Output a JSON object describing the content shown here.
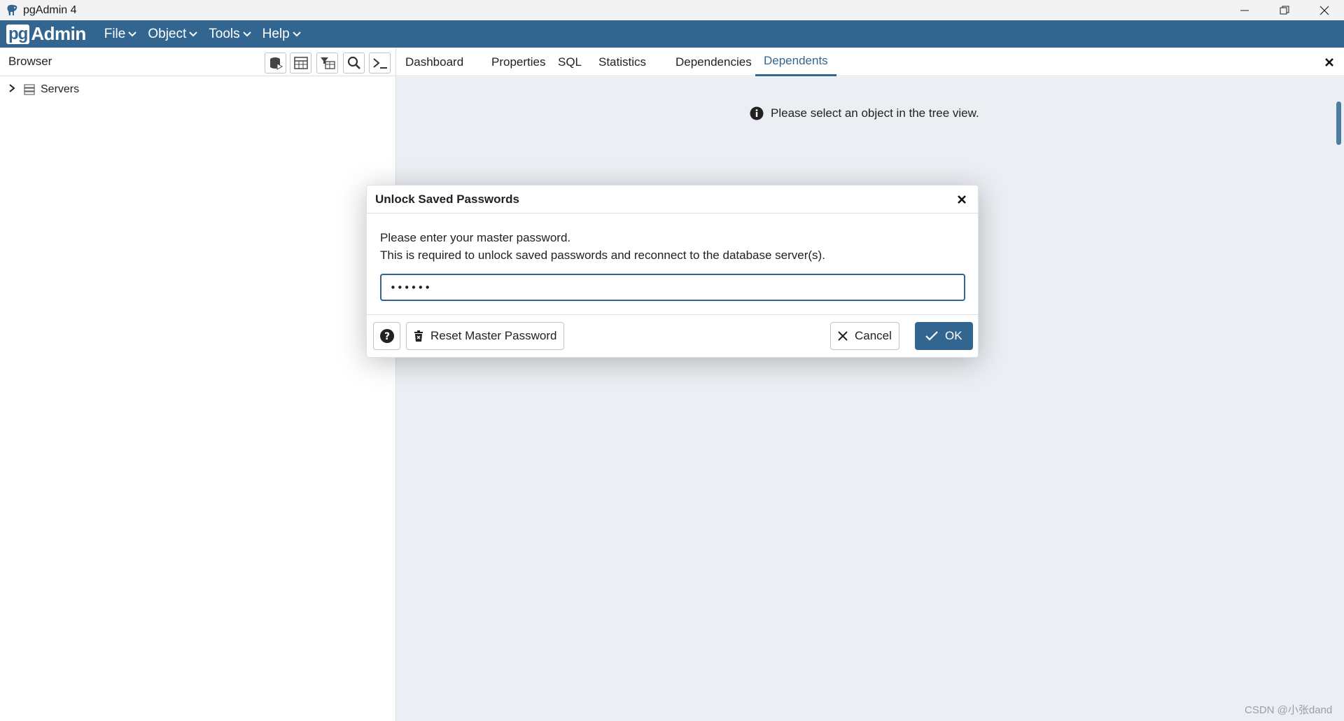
{
  "window": {
    "title": "pgAdmin 4",
    "controls": [
      "minimize-icon",
      "restore-icon",
      "close-icon"
    ]
  },
  "menubar": {
    "logo_pg": "pg",
    "logo_admin": "Admin",
    "items": [
      {
        "label": "File"
      },
      {
        "label": "Object"
      },
      {
        "label": "Tools"
      },
      {
        "label": "Help"
      }
    ]
  },
  "browser": {
    "title": "Browser",
    "toolbar_icons": [
      "query-tool-icon",
      "view-data-icon",
      "filtered-rows-icon",
      "search-objects-icon",
      "psql-tool-icon"
    ],
    "tree": [
      {
        "label": "Servers",
        "icon": "servers-icon",
        "expanded": false
      }
    ]
  },
  "tabs": [
    {
      "label": "Dashboard",
      "active": false
    },
    {
      "label": "Properties",
      "active": false
    },
    {
      "label": "SQL",
      "active": false
    },
    {
      "label": "Statistics",
      "active": false
    },
    {
      "label": "Dependencies",
      "active": false
    },
    {
      "label": "Dependents",
      "active": true
    }
  ],
  "content": {
    "info_message": "Please select an object in the tree view."
  },
  "dialog": {
    "title": "Unlock Saved Passwords",
    "line1": "Please enter your master password.",
    "line2": "This is required to unlock saved passwords and reconnect to the database server(s).",
    "password_value": "••••••",
    "reset_label": "Reset Master Password",
    "cancel_label": "Cancel",
    "ok_label": "OK"
  },
  "watermark": "CSDN @小张dand",
  "colors": {
    "brand": "#326690",
    "content_bg": "#ebeef3"
  }
}
